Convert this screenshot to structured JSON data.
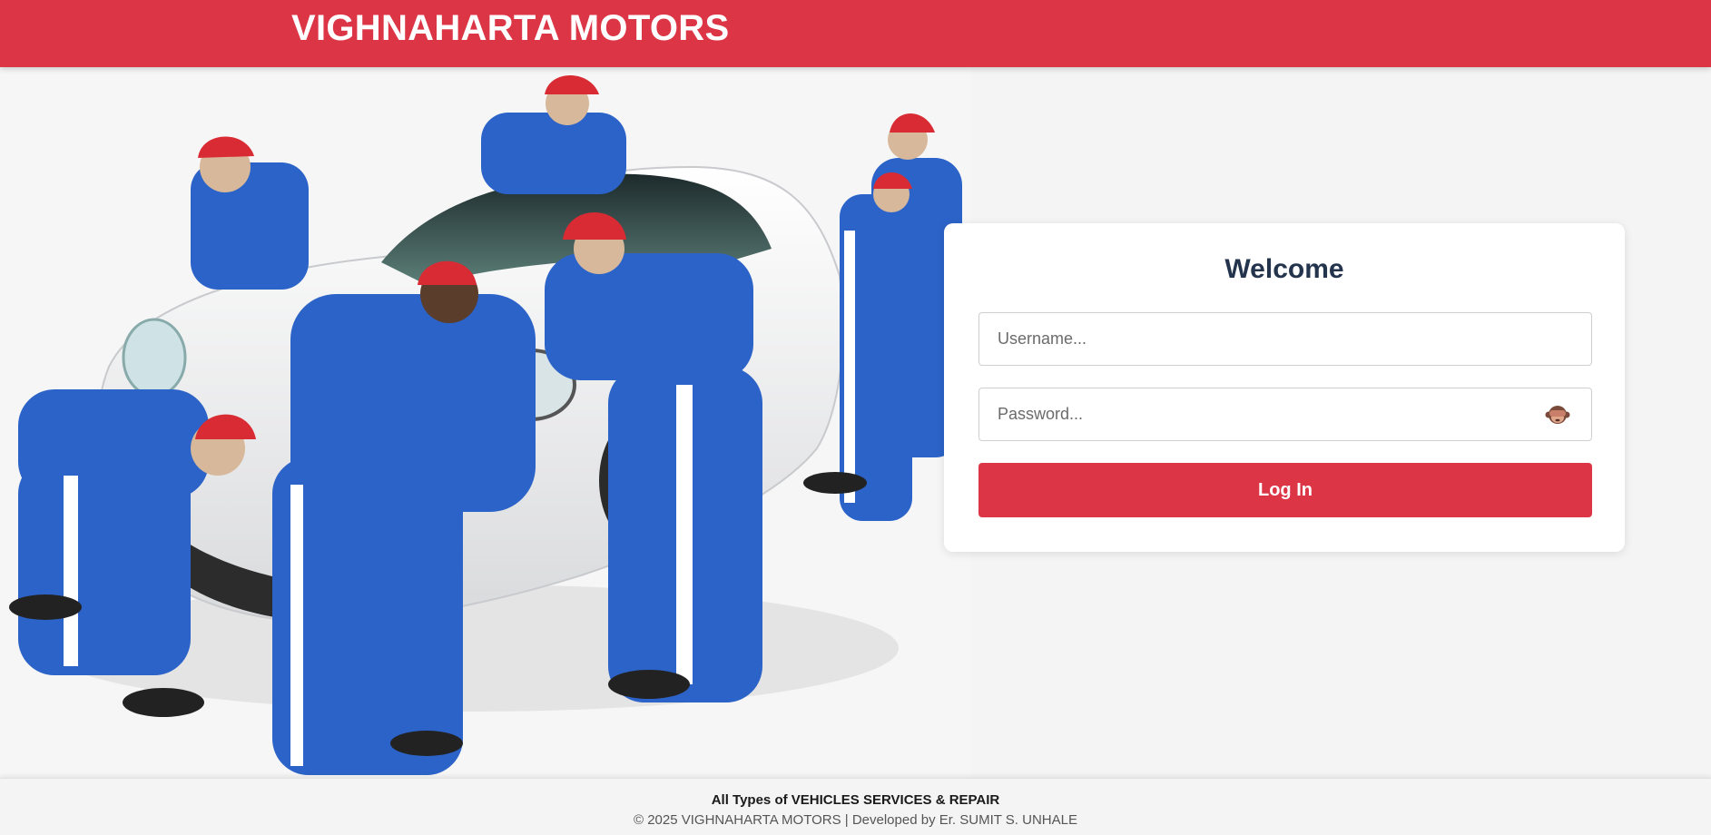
{
  "header": {
    "brand": "VIGHNAHARTA MOTORS",
    "color": "#dc3545"
  },
  "hero": {
    "image": "mechanics-in-blue-uniforms-polishing-white-sports-car"
  },
  "login": {
    "title": "Welcome",
    "username_placeholder": "Username...",
    "password_placeholder": "Password...",
    "toggle_icon": "see-no-evil-monkey-icon",
    "submit_label": "Log In"
  },
  "footer": {
    "tagline": "All Types of VEHICLES SERVICES & REPAIR",
    "copyright": "© 2025 VIGHNAHARTA MOTORS   | Developed by Er. SUMIT S. UNHALE"
  }
}
